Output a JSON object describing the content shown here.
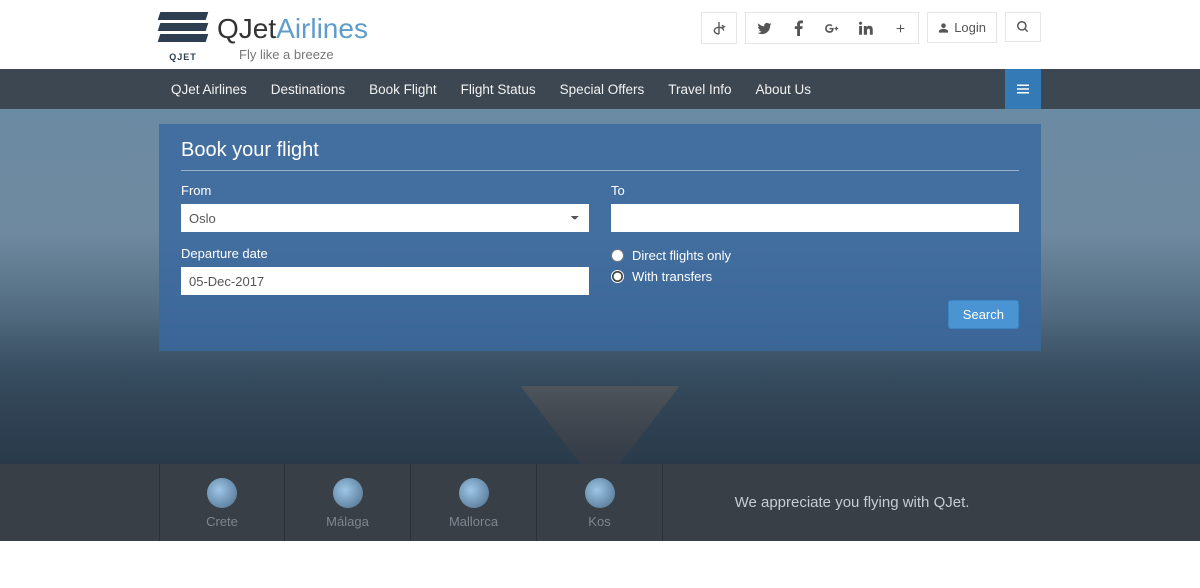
{
  "brand": {
    "name1": "QJet",
    "name2": "Airlines",
    "tagline": "Fly like a breeze",
    "logo_text": "QJET"
  },
  "header": {
    "login_label": "Login"
  },
  "nav": {
    "items": [
      "QJet Airlines",
      "Destinations",
      "Book Flight",
      "Flight Status",
      "Special Offers",
      "Travel Info",
      "About Us"
    ]
  },
  "booking": {
    "title": "Book your flight",
    "from_label": "From",
    "to_label": "To",
    "from_value": "Oslo",
    "to_value": "",
    "date_label": "Departure date",
    "date_value": "05-Dec-2017",
    "direct_label": "Direct flights only",
    "transfers_label": "With transfers",
    "flight_type_selected": "transfers",
    "search_label": "Search"
  },
  "destinations": {
    "items": [
      {
        "name": "Crete"
      },
      {
        "name": "Málaga"
      },
      {
        "name": "Mallorca"
      },
      {
        "name": "Kos"
      }
    ],
    "message": "We appreciate you flying with QJet."
  }
}
